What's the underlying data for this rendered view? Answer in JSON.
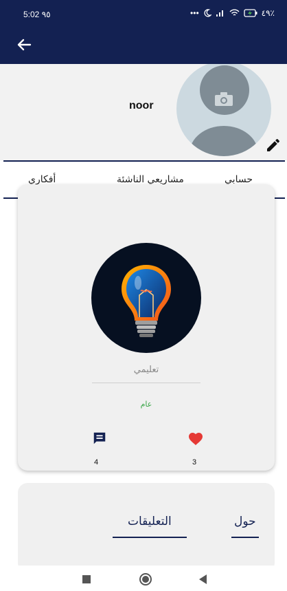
{
  "status_bar": {
    "time": "5:02 ٩٥",
    "icons": [
      "dots-icon",
      "moon-icon",
      "signal-icon",
      "wifi-icon",
      "battery-charging-icon"
    ],
    "battery": "٤٩٪"
  },
  "app_bar": {
    "back_icon": "back-arrow-icon",
    "bg_color": "#132152"
  },
  "profile": {
    "name": "noor",
    "avatar_icon": "camera-icon",
    "edit_icon": "pencil-icon"
  },
  "tabs": [
    {
      "label": "أفكاري"
    },
    {
      "label": "مشاريعي الناشئة"
    },
    {
      "label": "حسابي"
    }
  ],
  "idea_card": {
    "image": "lightbulb-illustration",
    "title": "تعليمي",
    "visibility": "عام",
    "comment_count": "4",
    "like_count": "3",
    "like_color": "#e53935"
  },
  "detail_tabs": {
    "about": "حول",
    "comments": "التعليقات"
  },
  "nav_bar": [
    "recent-apps-button",
    "home-button",
    "back-button"
  ]
}
